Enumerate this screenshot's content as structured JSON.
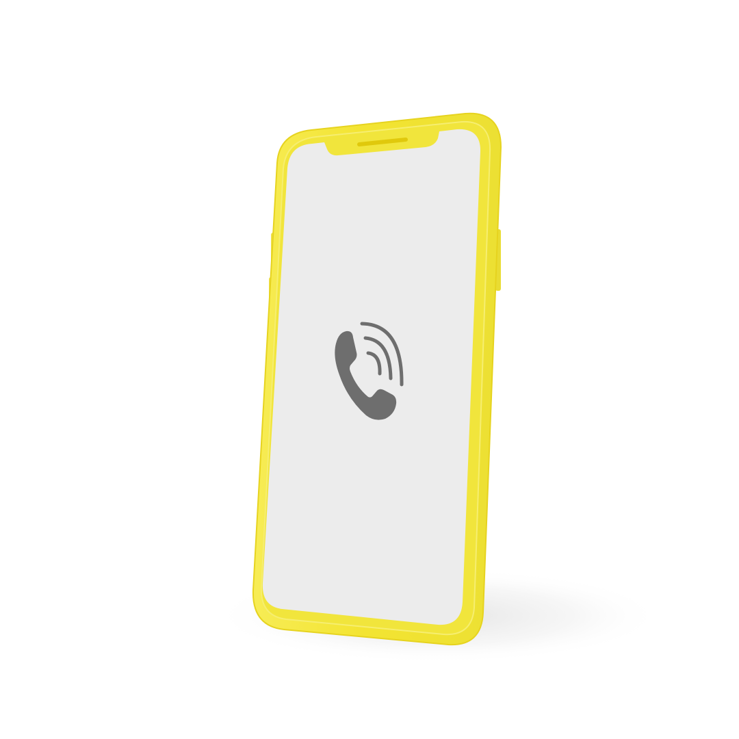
{
  "scene": {
    "background_color": "#ffffff",
    "shadow_color": "#d9d9d9"
  },
  "phone": {
    "frame_color": "#f3e432",
    "frame_edge_color": "#e8d21a",
    "frame_highlight_color": "#faf27a",
    "screen_color": "#ececec",
    "speaker_color": "#e0c90c"
  },
  "screen": {
    "icon": "phone-call-icon",
    "icon_color": "#6e6e6e"
  }
}
